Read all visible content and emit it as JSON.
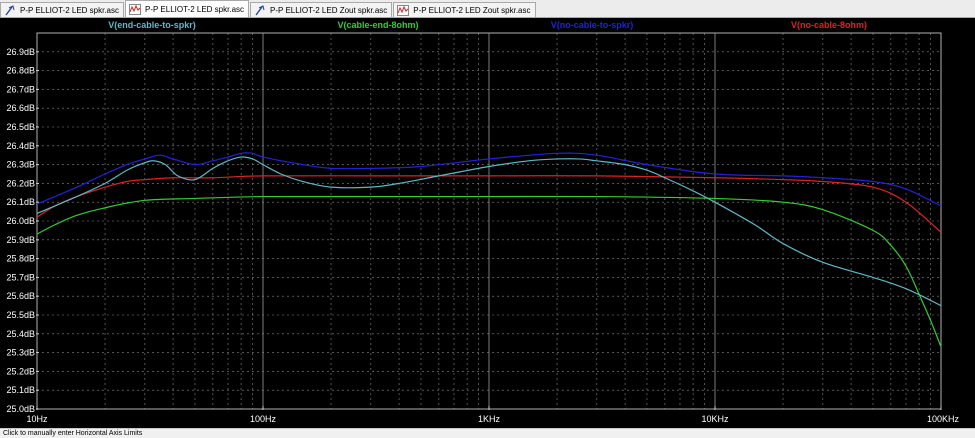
{
  "tabs": [
    {
      "label": "P-P ELLIOT-2 LED spkr.asc",
      "icon": "schematic-icon",
      "active": false
    },
    {
      "label": "P-P ELLIOT-2 LED spkr.asc",
      "icon": "waveform-icon",
      "active": true
    },
    {
      "label": "P-P ELLIOT-2 LED Zout spkr.asc",
      "icon": "schematic-icon",
      "active": false
    },
    {
      "label": "P-P ELLIOT-2 LED Zout spkr.asc",
      "icon": "waveform-icon",
      "active": false
    }
  ],
  "status_text": "Click to manually enter Horizontal Axis Limits",
  "chart_data": {
    "type": "line",
    "xscale": "log",
    "xlim": [
      10,
      100000
    ],
    "ylim": [
      25.0,
      27.0
    ],
    "yunit": "dB",
    "x_ticks": [
      {
        "value": 10,
        "label": "10Hz"
      },
      {
        "value": 100,
        "label": "100Hz"
      },
      {
        "value": 1000,
        "label": "1KHz"
      },
      {
        "value": 10000,
        "label": "10KHz"
      },
      {
        "value": 100000,
        "label": "100KHz"
      }
    ],
    "y_ticks": [
      "25.0dB",
      "25.1dB",
      "25.2dB",
      "25.3dB",
      "25.4dB",
      "25.5dB",
      "25.6dB",
      "25.7dB",
      "25.8dB",
      "25.9dB",
      "26.0dB",
      "26.1dB",
      "26.2dB",
      "26.3dB",
      "26.4dB",
      "26.5dB",
      "26.6dB",
      "26.7dB",
      "26.8dB",
      "26.9dB"
    ],
    "grid": true,
    "background": "#000000",
    "series": [
      {
        "name": "V(end-cable-to-spkr)",
        "color": "#5fb8c8",
        "x": [
          10,
          15,
          20,
          25,
          30,
          33,
          37,
          42,
          50,
          60,
          70,
          80,
          90,
          100,
          120,
          150,
          200,
          300,
          400,
          600,
          1000,
          1500,
          2000,
          2500,
          3000,
          4000,
          5000,
          6000,
          8000,
          10000,
          15000,
          20000,
          30000,
          50000,
          70000,
          100000
        ],
        "y": [
          26.04,
          26.13,
          26.2,
          26.27,
          26.31,
          26.32,
          26.3,
          26.24,
          26.22,
          26.28,
          26.32,
          26.34,
          26.33,
          26.3,
          26.25,
          26.21,
          26.18,
          26.18,
          26.2,
          26.24,
          26.29,
          26.32,
          26.33,
          26.33,
          26.32,
          26.3,
          26.27,
          26.23,
          26.16,
          26.1,
          25.98,
          25.88,
          25.78,
          25.7,
          25.64,
          25.55
        ]
      },
      {
        "name": "V(cable-end-8ohm)",
        "color": "#33cc33",
        "x": [
          10,
          12,
          15,
          20,
          30,
          50,
          100,
          300,
          1000,
          3000,
          10000,
          20000,
          30000,
          50000,
          60000,
          70000,
          80000,
          90000,
          100000
        ],
        "y": [
          25.93,
          25.98,
          26.03,
          26.07,
          26.11,
          26.12,
          26.13,
          26.13,
          26.13,
          26.13,
          26.12,
          26.1,
          26.06,
          25.95,
          25.87,
          25.76,
          25.61,
          25.47,
          25.33
        ]
      },
      {
        "name": "V(no-cable-to-spkr)",
        "color": "#2222dd",
        "x": [
          10,
          15,
          20,
          25,
          30,
          35,
          40,
          50,
          60,
          70,
          80,
          90,
          100,
          150,
          200,
          300,
          500,
          1000,
          2000,
          3000,
          5000,
          10000,
          20000,
          30000,
          50000,
          70000,
          100000
        ],
        "y": [
          26.09,
          26.18,
          26.25,
          26.3,
          26.33,
          26.35,
          26.33,
          26.3,
          26.32,
          26.34,
          26.36,
          26.36,
          26.34,
          26.3,
          26.28,
          26.28,
          26.29,
          26.33,
          26.36,
          26.35,
          26.3,
          26.25,
          26.24,
          26.23,
          26.21,
          26.17,
          26.08
        ]
      },
      {
        "name": "V(no-cable-8ohm)",
        "color": "#dd2222",
        "x": [
          10,
          12,
          15,
          20,
          25,
          30,
          40,
          60,
          100,
          300,
          1000,
          3000,
          10000,
          20000,
          30000,
          50000,
          70000,
          100000
        ],
        "y": [
          26.02,
          26.08,
          26.13,
          26.18,
          26.21,
          26.22,
          26.23,
          26.23,
          26.24,
          26.24,
          26.24,
          26.24,
          26.23,
          26.22,
          26.21,
          26.18,
          26.1,
          25.94
        ]
      }
    ]
  }
}
